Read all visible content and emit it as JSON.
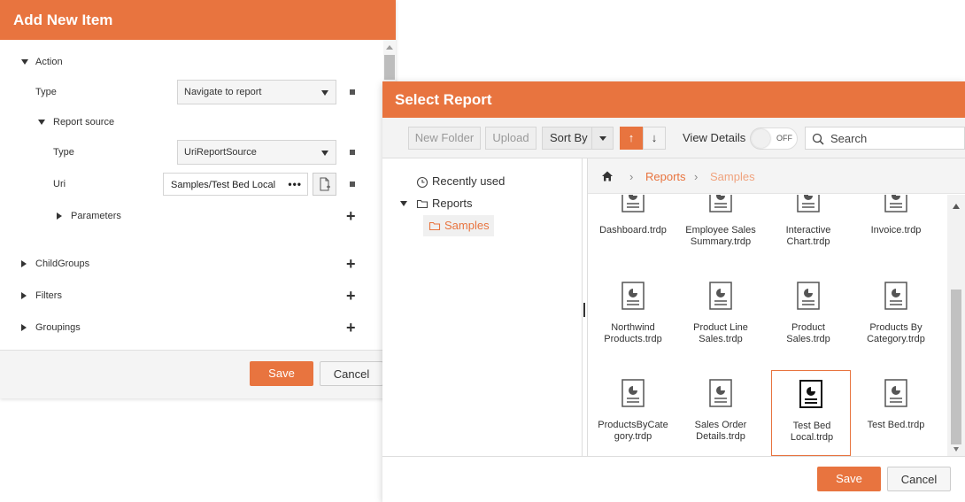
{
  "colors": {
    "accent": "#e8743f",
    "header_text": "#ffffff"
  },
  "add_item": {
    "title": "Add New Item",
    "action_label": "Action",
    "type_label": "Type",
    "type_value": "Navigate to report",
    "report_source_label": "Report source",
    "rs_type_label": "Type",
    "rs_type_value": "UriReportSource",
    "uri_label": "Uri",
    "uri_value": "Samples/Test Bed Local",
    "uri_more": "•••",
    "parameters_label": "Parameters",
    "child_groups_label": "ChildGroups",
    "filters_label": "Filters",
    "groupings_label": "Groupings",
    "plus": "+",
    "save_label": "Save",
    "cancel_label": "Cancel"
  },
  "select_report": {
    "title": "Select Report",
    "toolbar": {
      "new_folder": "New Folder",
      "upload": "Upload",
      "sort_by": "Sort By",
      "sort_asc": "↑",
      "sort_desc": "↓",
      "view_details": "View Details",
      "toggle_state": "OFF",
      "search_placeholder": "Search"
    },
    "tree": {
      "recently_used": "Recently used",
      "reports": "Reports",
      "samples": "Samples"
    },
    "breadcrumb": {
      "sep": "›",
      "reports": "Reports",
      "samples": "Samples"
    },
    "files": [
      {
        "line1": "Dashboard.trdp",
        "line2": ""
      },
      {
        "line1": "Employee Sales",
        "line2": "Summary.trdp"
      },
      {
        "line1": "Interactive",
        "line2": "Chart.trdp"
      },
      {
        "line1": "Invoice.trdp",
        "line2": ""
      },
      {
        "line1": "Northwind",
        "line2": "Products.trdp"
      },
      {
        "line1": "Product Line",
        "line2": "Sales.trdp"
      },
      {
        "line1": "Product",
        "line2": "Sales.trdp"
      },
      {
        "line1": "Products By",
        "line2": "Category.trdp"
      },
      {
        "line1": "ProductsByCate",
        "line2": "gory.trdp"
      },
      {
        "line1": "Sales Order",
        "line2": "Details.trdp"
      },
      {
        "line1": "Test Bed",
        "line2": "Local.trdp"
      },
      {
        "line1": "Test Bed.trdp",
        "line2": ""
      }
    ],
    "save_label": "Save",
    "cancel_label": "Cancel"
  }
}
